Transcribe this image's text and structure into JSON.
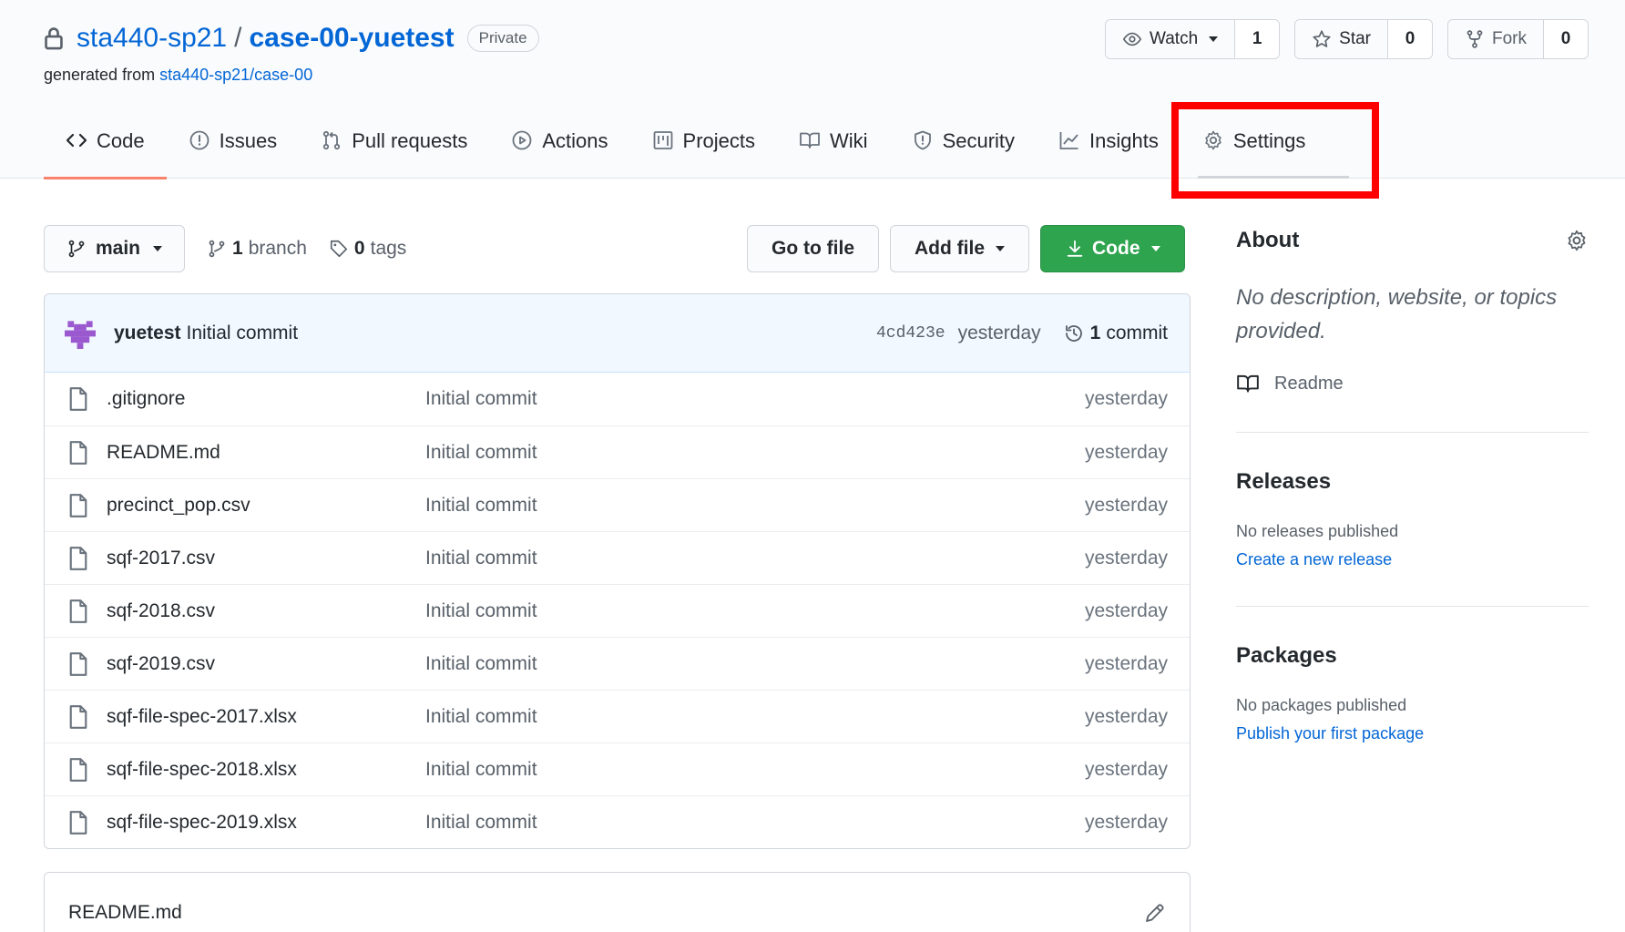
{
  "repo": {
    "owner": "sta440-sp21",
    "separator": "/",
    "name": "case-00-yuetest",
    "visibility": "Private",
    "generated_prefix": "generated from",
    "generated_source": "sta440-sp21/case-00"
  },
  "actions": {
    "watch_label": "Watch",
    "watch_count": "1",
    "star_label": "Star",
    "star_count": "0",
    "fork_label": "Fork",
    "fork_count": "0"
  },
  "tabs": [
    {
      "label": "Code",
      "icon": "code-icon",
      "selected": true
    },
    {
      "label": "Issues",
      "icon": "issue-opened-icon"
    },
    {
      "label": "Pull requests",
      "icon": "git-pull-request-icon"
    },
    {
      "label": "Actions",
      "icon": "play-icon"
    },
    {
      "label": "Projects",
      "icon": "project-icon"
    },
    {
      "label": "Wiki",
      "icon": "book-icon"
    },
    {
      "label": "Security",
      "icon": "shield-icon"
    },
    {
      "label": "Insights",
      "icon": "graph-icon"
    },
    {
      "label": "Settings",
      "icon": "gear-icon"
    }
  ],
  "branch": {
    "current": "main",
    "branch_count": "1",
    "branch_word": "branch",
    "tag_count": "0",
    "tag_word": "tags"
  },
  "file_buttons": {
    "go_to_file": "Go to file",
    "add_file": "Add file",
    "code": "Code"
  },
  "latest_commit": {
    "author": "yuetest",
    "message": "Initial commit",
    "sha": "4cd423e",
    "age": "yesterday",
    "commit_count": "1",
    "commit_word": "commit"
  },
  "files": [
    {
      "name": ".gitignore",
      "message": "Initial commit",
      "age": "yesterday"
    },
    {
      "name": "README.md",
      "message": "Initial commit",
      "age": "yesterday"
    },
    {
      "name": "precinct_pop.csv",
      "message": "Initial commit",
      "age": "yesterday"
    },
    {
      "name": "sqf-2017.csv",
      "message": "Initial commit",
      "age": "yesterday"
    },
    {
      "name": "sqf-2018.csv",
      "message": "Initial commit",
      "age": "yesterday"
    },
    {
      "name": "sqf-2019.csv",
      "message": "Initial commit",
      "age": "yesterday"
    },
    {
      "name": "sqf-file-spec-2017.xlsx",
      "message": "Initial commit",
      "age": "yesterday"
    },
    {
      "name": "sqf-file-spec-2018.xlsx",
      "message": "Initial commit",
      "age": "yesterday"
    },
    {
      "name": "sqf-file-spec-2019.xlsx",
      "message": "Initial commit",
      "age": "yesterday"
    }
  ],
  "readme": {
    "title": "README.md"
  },
  "sidebar": {
    "about_heading": "About",
    "about_description": "No description, website, or topics provided.",
    "readme_label": "Readme",
    "releases_heading": "Releases",
    "releases_empty": "No releases published",
    "releases_link": "Create a new release",
    "packages_heading": "Packages",
    "packages_empty": "No packages published",
    "packages_link": "Publish your first package"
  },
  "colors": {
    "link": "#0366d6",
    "primary_button": "#2ea44f",
    "selected_tab_underline": "#f9826c",
    "annotation_box": "#ff0000"
  }
}
